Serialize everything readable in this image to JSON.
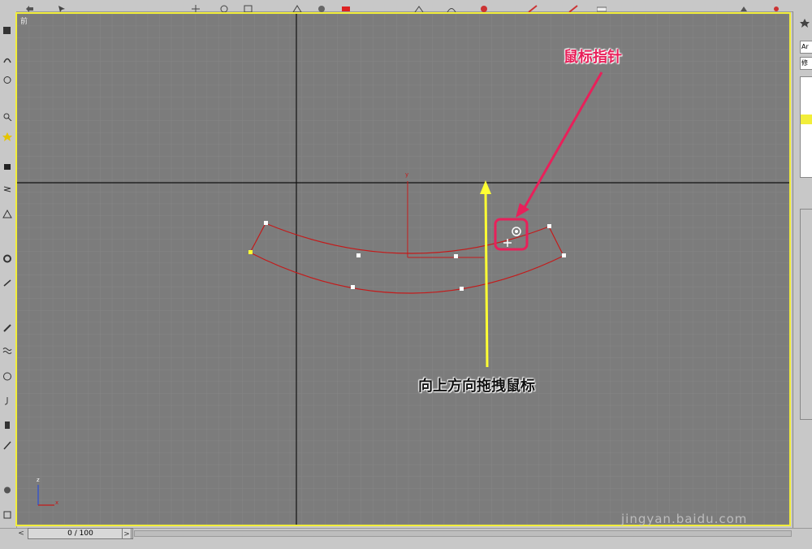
{
  "viewport": {
    "label": "前",
    "grid": true
  },
  "annotations": {
    "cursor_callout": "鼠标指针",
    "drag_callout": "向上方向拖拽鼠标"
  },
  "timeline": {
    "frame_display": "0 / 100",
    "prev_label": "<",
    "next_label": ">"
  },
  "right_panel": {
    "field1": "Ar",
    "field2": "修"
  },
  "watermark": "jingyan.baidu.com",
  "axis_gizmo": {
    "z_label": "z",
    "x_label": "x",
    "y_label": "y"
  },
  "colors": {
    "viewport_border": "#f2ee3a",
    "shape_stroke": "#c41a1a",
    "callout_pink": "#e8205a",
    "arrow_yellow": "#ffff33",
    "grid_bg": "#7c7c7c"
  }
}
